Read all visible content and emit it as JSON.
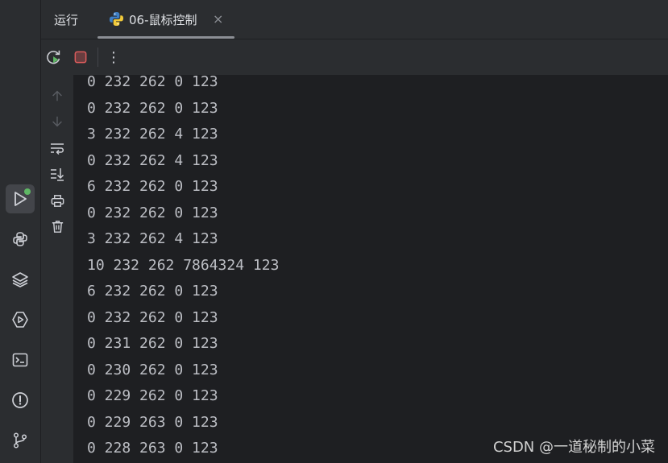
{
  "tabs": {
    "run_label": "运行",
    "file_tab_label": "06-鼠标控制",
    "close_glyph": "×"
  },
  "toolbar": {
    "more_glyph": "⋮"
  },
  "console": {
    "lines": [
      "0 232 262 0 123",
      "0 232 262 0 123",
      "3 232 262 4 123",
      "0 232 262 4 123",
      "6 232 262 0 123",
      "0 232 262 0 123",
      "3 232 262 4 123",
      "10 232 262 7864324 123",
      "6 232 262 0 123",
      "0 232 262 0 123",
      "0 231 262 0 123",
      "0 230 262 0 123",
      "0 229 262 0 123",
      "0 229 263 0 123",
      "0 228 263 0 123"
    ]
  },
  "watermark": "CSDN @一道秘制的小菜",
  "colors": {
    "background": "#1e1f22",
    "panel": "#2b2d30",
    "text": "#bcbec4",
    "run_green": "#5fb865",
    "stop_red": "#db5c5c"
  },
  "icons": {
    "activity": [
      "run-icon",
      "python-console-icon",
      "layers-icon",
      "services-icon",
      "terminal-icon",
      "problems-icon",
      "git-icon"
    ],
    "toolbar": [
      "rerun-icon",
      "stop-icon",
      "more-icon"
    ],
    "console_strip": [
      "scroll-up-icon",
      "scroll-down-icon",
      "soft-wrap-icon",
      "scroll-to-end-icon",
      "print-icon",
      "clear-icon"
    ]
  }
}
